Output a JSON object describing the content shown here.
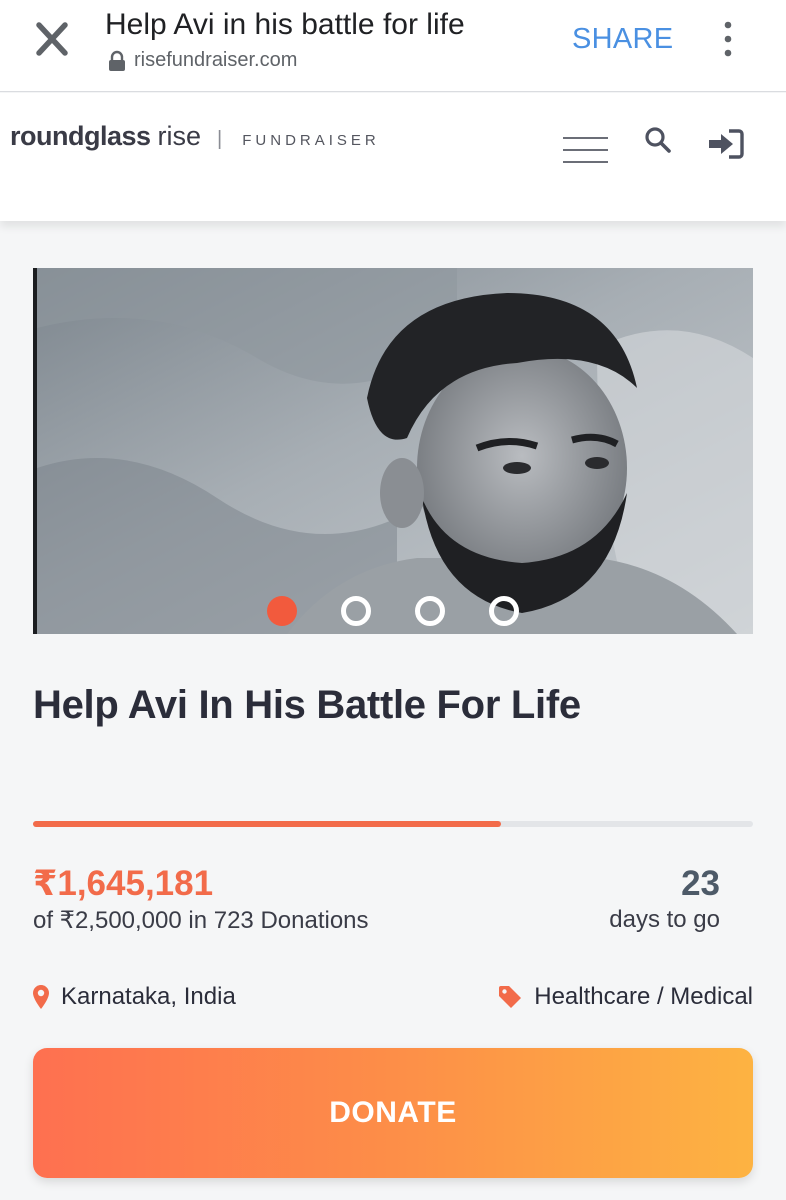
{
  "browser": {
    "title": "Help Avi in his battle for life",
    "url": "risefundraiser.com",
    "share_label": "SHARE"
  },
  "site": {
    "logo_bold": "roundglass",
    "logo_light": "rise",
    "logo_separator": "|",
    "logo_sub": "FUNDRAISER"
  },
  "carousel": {
    "slides_count": 4,
    "active_index": 0
  },
  "campaign": {
    "title": "Help Avi In His Battle For Life",
    "progress_fraction": 0.65,
    "raised": "₹1,645,181",
    "goal_text": "of ₹2,500,000 in 723 Donations",
    "days_left": "23",
    "days_label": "days to go",
    "location": "Karnataka, India",
    "category": "Healthcare / Medical"
  },
  "actions": {
    "donate_label": "DONATE"
  },
  "colors": {
    "accent": "#f26b4a",
    "share_blue": "#4a90e2",
    "donate_gradient_start": "#fe7050",
    "donate_gradient_end": "#fdb342"
  }
}
